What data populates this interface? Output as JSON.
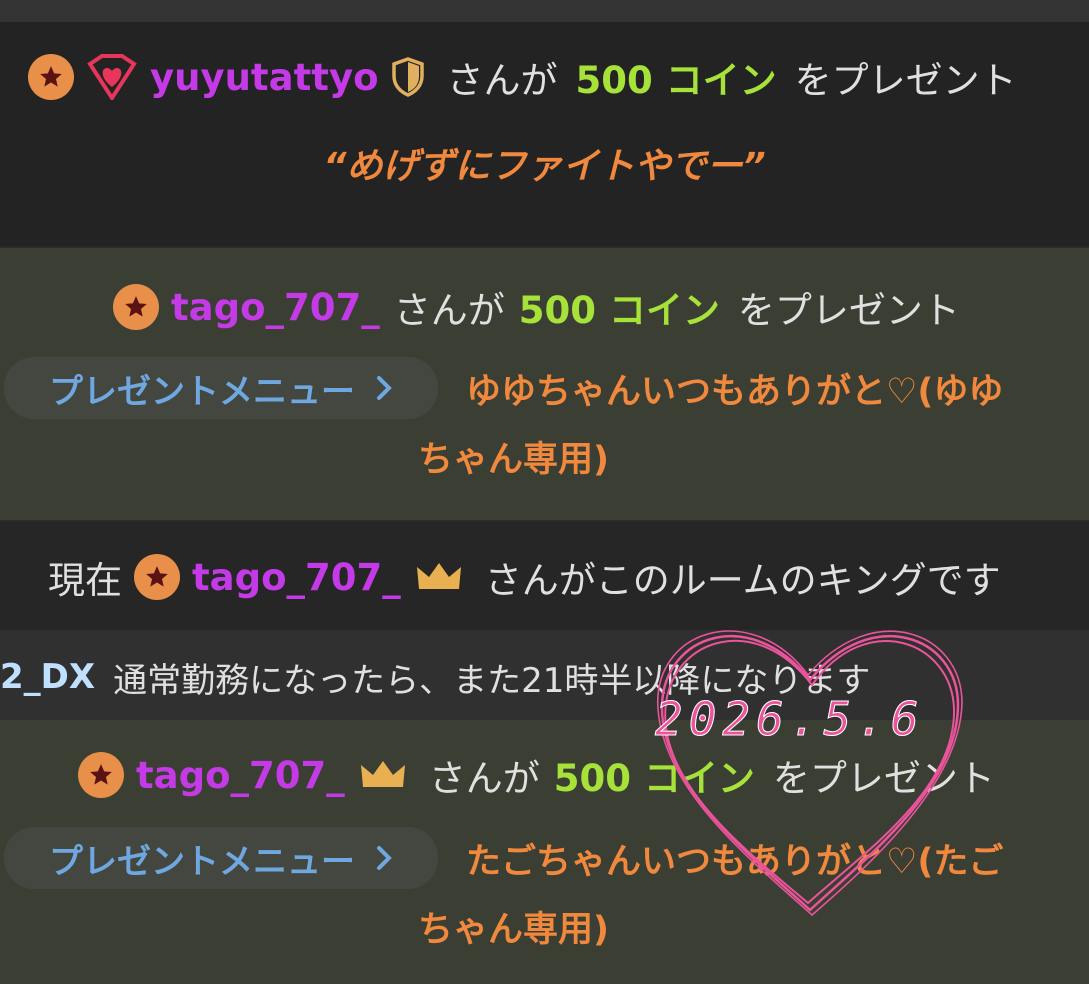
{
  "colors": {
    "dark_band": "#242424",
    "green_band": "#3b3e33",
    "username": "#c33ae6",
    "coins": "#a6e23a",
    "message": "#f0883e",
    "menu_link": "#6fa8e0",
    "heart_stamp": "#e9549a"
  },
  "icons": [
    "star-badge-icon",
    "heart-gem-icon",
    "shield-icon",
    "crown-icon",
    "chevron-right-icon"
  ],
  "gift1": {
    "username": "yuyutattyo",
    "san_ga": "さんが",
    "coins": "500 コイン",
    "wo_present": "をプレゼント",
    "message": "“めげずにファイトやでー”"
  },
  "gift2": {
    "username": "tago_707_",
    "san_ga": "さんが",
    "coins": "500 コイン",
    "wo_present": "をプレゼント",
    "menu_label": "プレゼントメニュー",
    "message_line1": "ゆゆちゃんいつもありがと♡(ゆゆ",
    "message_line2": "ちゃん専用)"
  },
  "king": {
    "prefix": "現在",
    "username": "tago_707_",
    "suffix": "さんがこのルームのキングです"
  },
  "chat": {
    "username": "2_DX",
    "text": "通常勤務になったら、また21時半以降になります"
  },
  "gift3": {
    "username": "tago_707_",
    "san_ga": "さんが",
    "coins": "500 コイン",
    "wo_present": "をプレゼント",
    "menu_label": "プレゼントメニュー",
    "message_line1": "たごちゃんいつもありがと♡(たご",
    "message_line2": "ちゃん専用)"
  },
  "stamp": {
    "date": "2026.5.6"
  }
}
